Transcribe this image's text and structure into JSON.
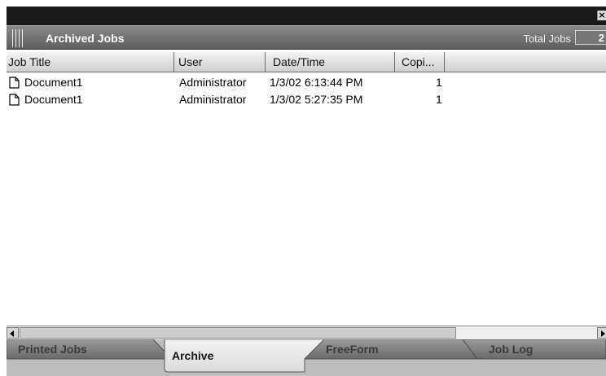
{
  "window": {
    "close_icon": "close-x-icon",
    "title": "Archived Jobs",
    "total_label": "Total Jobs",
    "total_value": "2"
  },
  "columns": [
    "Job Title",
    "User",
    "Date/Time",
    "Copi..."
  ],
  "jobs": [
    {
      "title": "Document1",
      "user": "Administrator",
      "datetime": "1/3/02 6:13:44 PM",
      "copies": "1",
      "icon": "document-icon"
    },
    {
      "title": "Document1",
      "user": "Administrator",
      "datetime": "1/3/02 5:27:35 PM",
      "copies": "1",
      "icon": "document-icon"
    }
  ],
  "tabs": [
    {
      "label": "Printed Jobs",
      "active": false
    },
    {
      "label": "Archive",
      "active": true
    },
    {
      "label": "FreeForm",
      "active": false
    },
    {
      "label": "Job Log",
      "active": false
    }
  ],
  "colors": {
    "titlebar": "#6e6e6e",
    "topbar": "#1a1a1a",
    "active_tab": "#e4e4e4",
    "inactive_tab": "#7a7a7a"
  }
}
